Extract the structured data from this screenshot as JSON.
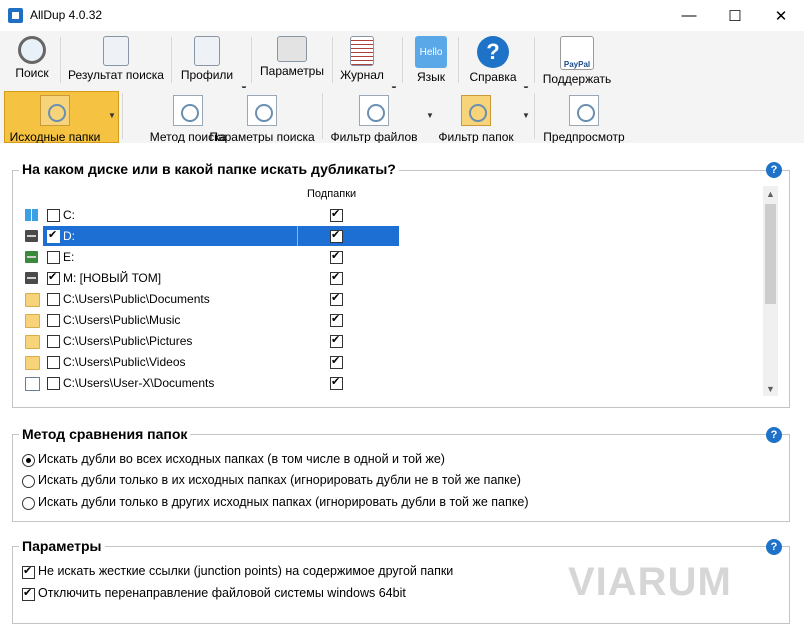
{
  "window": {
    "title": "AllDup 4.0.32",
    "minimize": "—",
    "maximize": "☐",
    "close": "✕"
  },
  "toolbar1": [
    {
      "label": "Поиск",
      "icon": "magnifier-icon"
    },
    {
      "label": "Результат поиска",
      "icon": "result-icon"
    },
    {
      "label": "Профили",
      "icon": "profiles-icon"
    },
    {
      "label": "Параметры",
      "icon": "settings-icon"
    },
    {
      "label": "Журнал",
      "icon": "log-icon"
    },
    {
      "label": "Язык",
      "icon": "language-icon",
      "badge": "Hello"
    },
    {
      "label": "Справка",
      "icon": "help-icon",
      "badge": "?"
    },
    {
      "label": "Поддержать",
      "icon": "paypal-icon",
      "badge": "PayPal"
    }
  ],
  "toolbar2": [
    {
      "label": "Исходные папки",
      "icon": "source-folders-icon",
      "active": true
    },
    {
      "label": "Метод поиска",
      "icon": "search-method-icon"
    },
    {
      "label": "Параметры поиска",
      "icon": "search-params-icon"
    },
    {
      "label": "Фильтр файлов",
      "icon": "file-filter-icon"
    },
    {
      "label": "Фильтр папок",
      "icon": "folder-filter-icon"
    },
    {
      "label": "Предпросмотр",
      "icon": "preview-icon"
    }
  ],
  "source_group": {
    "title": "На каком диске или в какой папке искать дубликаты?",
    "help": "?",
    "subfolders_header": "Подпапки",
    "rows": [
      {
        "name": "C:",
        "checked": false,
        "subfolders": true,
        "icon": "windows-drive-icon"
      },
      {
        "name": "D:",
        "checked": true,
        "subfolders": true,
        "icon": "drive-icon",
        "selected": true
      },
      {
        "name": "E:",
        "checked": false,
        "subfolders": true,
        "icon": "green-drive-icon"
      },
      {
        "name": "M: [НОВЫЙ ТОМ]",
        "checked": true,
        "subfolders": true,
        "icon": "drive-icon"
      },
      {
        "name": "C:\\Users\\Public\\Documents",
        "checked": false,
        "subfolders": true,
        "icon": "folder-icon"
      },
      {
        "name": "C:\\Users\\Public\\Music",
        "checked": false,
        "subfolders": true,
        "icon": "folder-icon"
      },
      {
        "name": "C:\\Users\\Public\\Pictures",
        "checked": false,
        "subfolders": true,
        "icon": "folder-icon"
      },
      {
        "name": "C:\\Users\\Public\\Videos",
        "checked": false,
        "subfolders": true,
        "icon": "folder-icon"
      },
      {
        "name": "C:\\Users\\User-X\\Documents",
        "checked": false,
        "subfolders": true,
        "icon": "document-icon"
      }
    ]
  },
  "compare_group": {
    "title": "Метод сравнения папок",
    "help": "?",
    "options": [
      {
        "label": "Искать дубли во всех исходных папках (в том числе в одной и той же)",
        "selected": true
      },
      {
        "label": "Искать дубли только в их исходных папках (игнорировать дубли не в той же папке)",
        "selected": false
      },
      {
        "label": "Искать дубли только в других исходных папках (игнорировать дубли в той же папке)",
        "selected": false
      }
    ]
  },
  "params_group": {
    "title": "Параметры",
    "help": "?",
    "options": [
      {
        "label": "Не искать жесткие ссылки (junction points) на содержимое другой папки",
        "checked": true
      },
      {
        "label": "Отключить перенаправление файловой системы windows 64bit",
        "checked": true
      }
    ]
  },
  "watermark": "VIARUM",
  "colors": {
    "selection": "#1e6fd3",
    "active_tab": "#f5c341",
    "help": "#1e73c8"
  }
}
